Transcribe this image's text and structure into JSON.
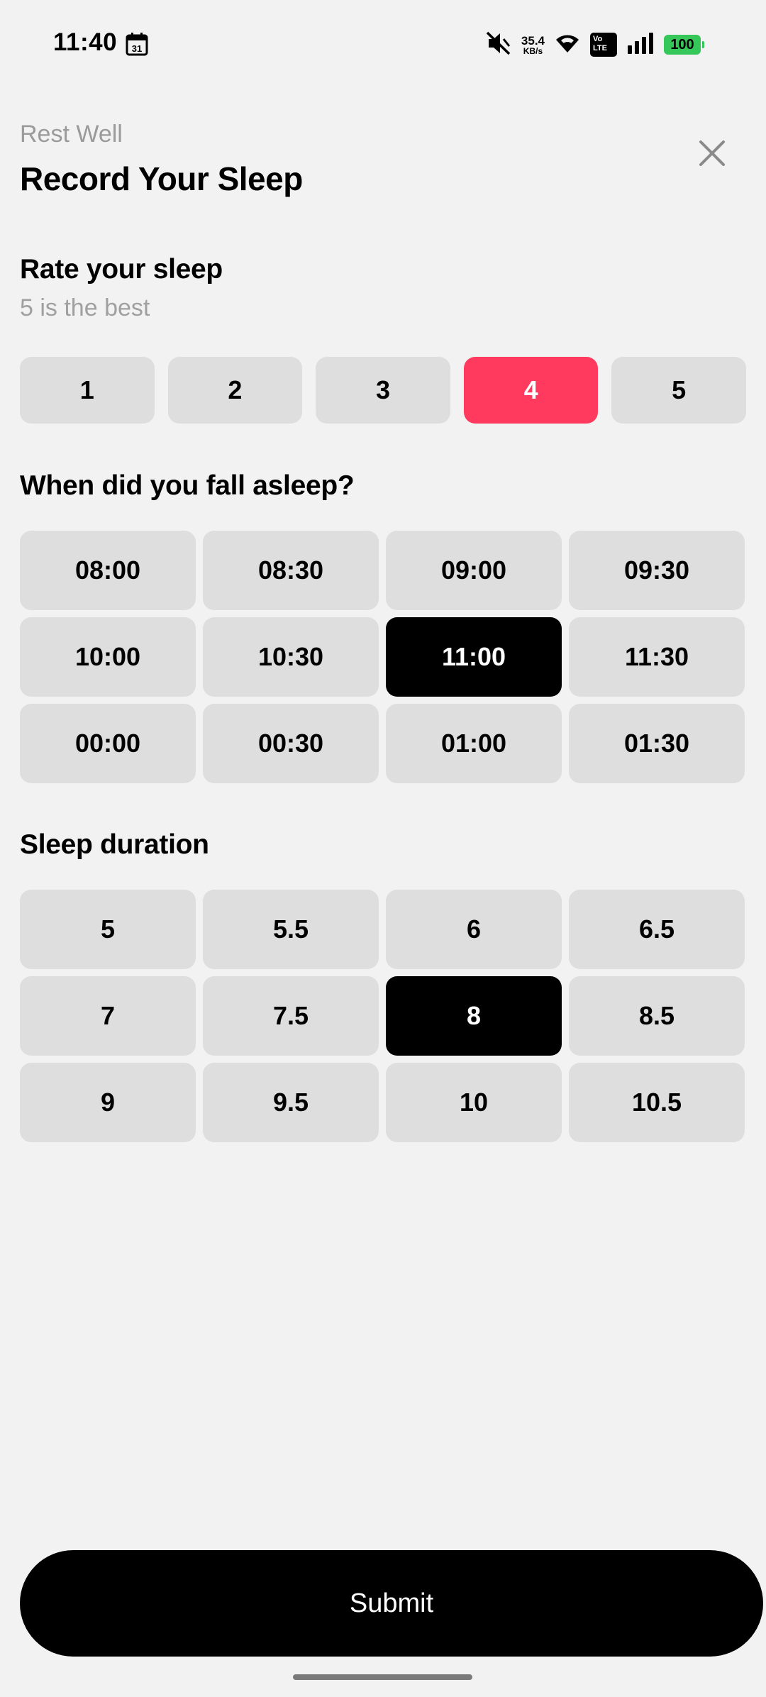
{
  "status_bar": {
    "time": "11:40",
    "calendar_day": "31",
    "net_speed_value": "35.4",
    "net_speed_unit": "KB/s",
    "volte_line1": "Vo",
    "volte_line2": "LTE",
    "battery": "100",
    "icons": [
      "calendar-icon",
      "mute-icon",
      "wifi-icon",
      "volte-icon",
      "signal-icon",
      "battery-icon"
    ]
  },
  "header": {
    "app_name": "Rest Well",
    "title": "Record Your Sleep",
    "close_icon": "close-icon"
  },
  "rating": {
    "title": "Rate your sleep",
    "subtitle": "5 is the best",
    "options": [
      "1",
      "2",
      "3",
      "4",
      "5"
    ],
    "selected": "4",
    "accent_color": "#ff3a5e"
  },
  "fall_asleep": {
    "title": "When did you fall asleep?",
    "options": [
      "08:00",
      "08:30",
      "09:00",
      "09:30",
      "10:00",
      "10:30",
      "11:00",
      "11:30",
      "00:00",
      "00:30",
      "01:00",
      "01:30"
    ],
    "selected": "11:00"
  },
  "duration": {
    "title": "Sleep duration",
    "options": [
      "5",
      "5.5",
      "6",
      "6.5",
      "7",
      "7.5",
      "8",
      "8.5",
      "9",
      "9.5",
      "10",
      "10.5"
    ],
    "selected": "8"
  },
  "submit_label": "Submit"
}
